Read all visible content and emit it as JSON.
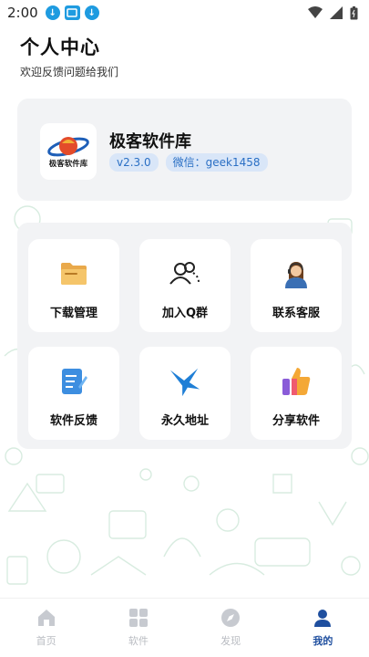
{
  "status_bar": {
    "time": "2:00"
  },
  "header": {
    "title": "个人中心",
    "subtitle": "欢迎反馈问题给我们"
  },
  "profile": {
    "app_name": "极客软件库",
    "logo_text": "极客软件库",
    "version": "v2.3.0",
    "wechat": "微信：geek1458"
  },
  "menu": {
    "download": "下载管理",
    "join_group": "加入Q群",
    "contact": "联系客服",
    "feedback": "软件反馈",
    "permanent": "永久地址",
    "share": "分享软件"
  },
  "tabbar": {
    "home": "首页",
    "apps": "软件",
    "discover": "发现",
    "mine": "我的",
    "active": "mine"
  },
  "colors": {
    "accent": "#1f4f9f",
    "badge_bg": "#d9e6f8",
    "badge_text": "#2a6fc4",
    "card_bg": "#f2f3f5",
    "inactive": "#b9bcc2"
  }
}
